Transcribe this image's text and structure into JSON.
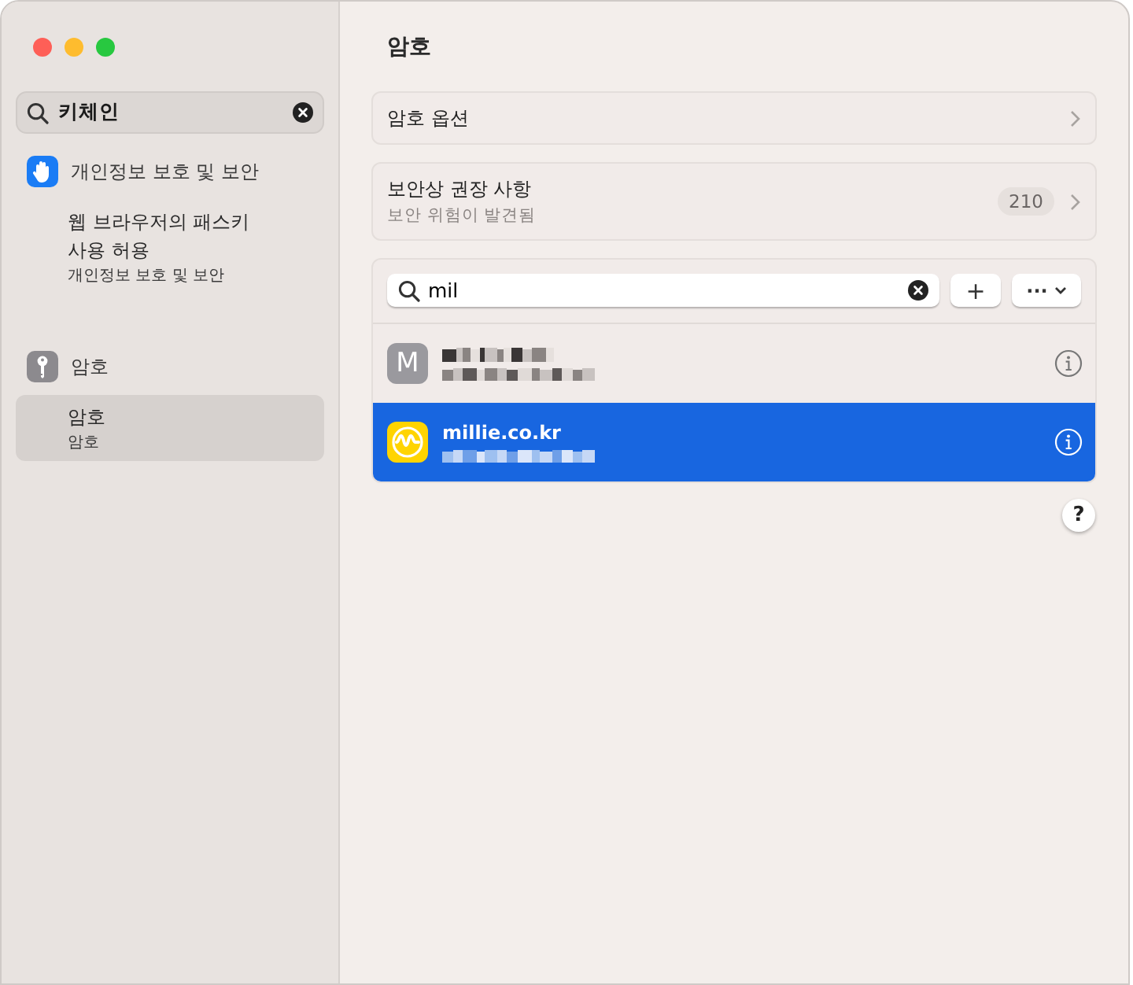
{
  "sidebar": {
    "search": {
      "value": "키체인"
    },
    "sections": [
      {
        "kind": "hand",
        "title": "개인정보 보호 및 보안",
        "items": [
          {
            "title": "웹 브라우저의 패스키 사용 허용",
            "subtitle": "개인정보 보호 및 보안",
            "selected": false
          }
        ]
      },
      {
        "kind": "key",
        "title": "암호",
        "items": [
          {
            "title": "암호",
            "subtitle": "암호",
            "selected": true
          }
        ]
      }
    ]
  },
  "main": {
    "title": "암호",
    "cards": [
      {
        "title": "암호 옵션"
      },
      {
        "title": "보안상 권장 사항",
        "subtitle": "보안 위험이 발견됨",
        "badge": "210"
      }
    ],
    "search": {
      "value": "mil"
    },
    "toolbar": {
      "add": "+",
      "more": "···"
    },
    "accounts": [
      {
        "kind": "letter",
        "letter": "M",
        "selected": false
      },
      {
        "kind": "logo",
        "title": "millie.co.kr",
        "selected": true
      }
    ],
    "help": "?"
  }
}
